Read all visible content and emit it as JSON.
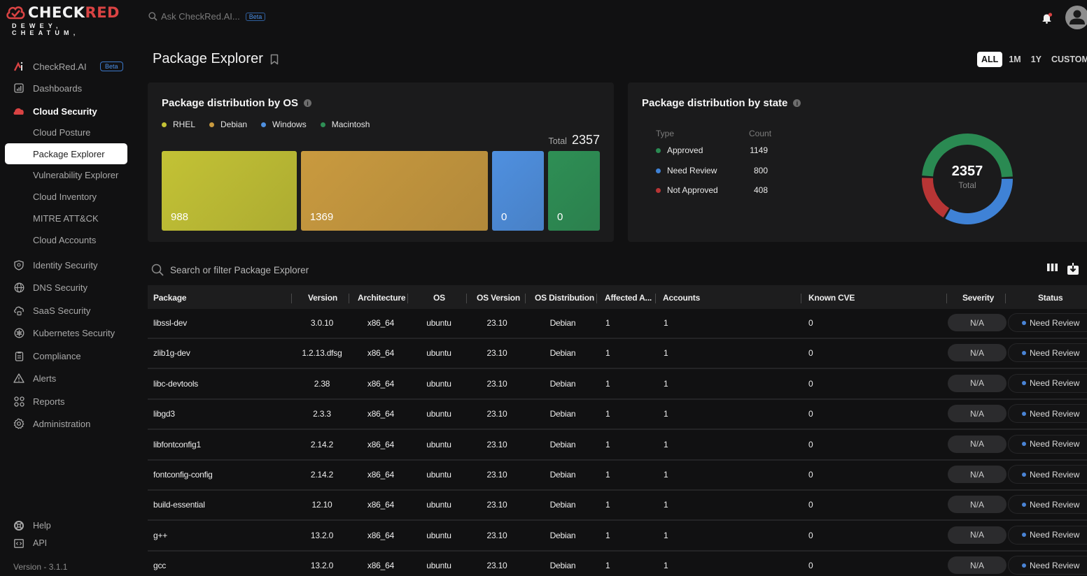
{
  "brand": {
    "name_white": "CHECK",
    "name_red": "RED",
    "tagline": "DEWEY, CHEATUM,"
  },
  "topbar": {
    "ask_placeholder": "Ask CheckRed.AI...",
    "ask_badge": "Beta"
  },
  "sidebar": {
    "items": [
      {
        "label": "CheckRed.AI",
        "icon": "checkred-ai-icon",
        "badge": "Beta"
      },
      {
        "label": "Dashboards",
        "icon": "dashboard-icon"
      },
      {
        "label": "Cloud Security",
        "icon": "cloud-icon"
      },
      {
        "label": "Cloud Posture"
      },
      {
        "label": "Package Explorer"
      },
      {
        "label": "Vulnerability Explorer"
      },
      {
        "label": "Cloud Inventory"
      },
      {
        "label": "MITRE ATT&CK"
      },
      {
        "label": "Cloud Accounts"
      },
      {
        "label": "Identity Security",
        "icon": "shield-icon"
      },
      {
        "label": "DNS Security",
        "icon": "globe-icon"
      },
      {
        "label": "SaaS Security",
        "icon": "cloud-lock-icon"
      },
      {
        "label": "Kubernetes Security",
        "icon": "kubernetes-icon"
      },
      {
        "label": "Compliance",
        "icon": "clipboard-icon"
      },
      {
        "label": "Alerts",
        "icon": "warning-icon"
      },
      {
        "label": "Reports",
        "icon": "grid-icon"
      },
      {
        "label": "Administration",
        "icon": "gear-icon"
      }
    ],
    "bottom": [
      {
        "label": "Help",
        "icon": "lifebuoy-icon"
      },
      {
        "label": "API",
        "icon": "code-icon"
      }
    ],
    "version": "Version - 3.1.1"
  },
  "page": {
    "title": "Package Explorer"
  },
  "time_range": {
    "options": [
      "ALL",
      "1M",
      "1Y",
      "CUSTOM"
    ],
    "selected": "ALL"
  },
  "os_card": {
    "title": "Package distribution by OS",
    "total_label": "Total",
    "total_value": "2357"
  },
  "state_card": {
    "title": "Package distribution by state",
    "col_type": "Type",
    "col_count": "Count",
    "center_value": "2357",
    "center_label": "Total"
  },
  "chart_data": [
    {
      "type": "treemap",
      "title": "Package distribution by OS",
      "categories": [
        "RHEL",
        "Debian",
        "Windows",
        "Macintosh"
      ],
      "values": [
        988,
        1369,
        0,
        0
      ],
      "colors": [
        "#c3c235",
        "#c99a3f",
        "#4f90e0",
        "#2e8f55"
      ],
      "total": 2357,
      "legend": "top-left"
    },
    {
      "type": "pie",
      "title": "Package distribution by state",
      "categories": [
        "Approved",
        "Need Review",
        "Not Approved"
      ],
      "values": [
        1149,
        800,
        408
      ],
      "colors": [
        "#2a8a52",
        "#3f82d6",
        "#b83535"
      ],
      "total": 2357
    }
  ],
  "table": {
    "search_placeholder": "Search or filter Package Explorer",
    "columns": [
      "Package",
      "Version",
      "Architecture",
      "OS",
      "OS Version",
      "OS Distribution",
      "Affected A...",
      "Accounts",
      "Known CVE",
      "Severity",
      "Status"
    ],
    "rows": [
      [
        "libssl-dev",
        "3.0.10",
        "x86_64",
        "ubuntu",
        "23.10",
        "Debian",
        "1",
        "1",
        "0",
        "N/A",
        "Need Review"
      ],
      [
        "zlib1g-dev",
        "1.2.13.dfsg",
        "x86_64",
        "ubuntu",
        "23.10",
        "Debian",
        "1",
        "1",
        "0",
        "N/A",
        "Need Review"
      ],
      [
        "libc-devtools",
        "2.38",
        "x86_64",
        "ubuntu",
        "23.10",
        "Debian",
        "1",
        "1",
        "0",
        "N/A",
        "Need Review"
      ],
      [
        "libgd3",
        "2.3.3",
        "x86_64",
        "ubuntu",
        "23.10",
        "Debian",
        "1",
        "1",
        "0",
        "N/A",
        "Need Review"
      ],
      [
        "libfontconfig1",
        "2.14.2",
        "x86_64",
        "ubuntu",
        "23.10",
        "Debian",
        "1",
        "1",
        "0",
        "N/A",
        "Need Review"
      ],
      [
        "fontconfig-config",
        "2.14.2",
        "x86_64",
        "ubuntu",
        "23.10",
        "Debian",
        "1",
        "1",
        "0",
        "N/A",
        "Need Review"
      ],
      [
        "build-essential",
        "12.10",
        "x86_64",
        "ubuntu",
        "23.10",
        "Debian",
        "1",
        "1",
        "0",
        "N/A",
        "Need Review"
      ],
      [
        "g++",
        "13.2.0",
        "x86_64",
        "ubuntu",
        "23.10",
        "Debian",
        "1",
        "1",
        "0",
        "N/A",
        "Need Review"
      ],
      [
        "gcc",
        "13.2.0",
        "x86_64",
        "ubuntu",
        "23.10",
        "Debian",
        "1",
        "1",
        "0",
        "N/A",
        "Need Review"
      ]
    ]
  }
}
